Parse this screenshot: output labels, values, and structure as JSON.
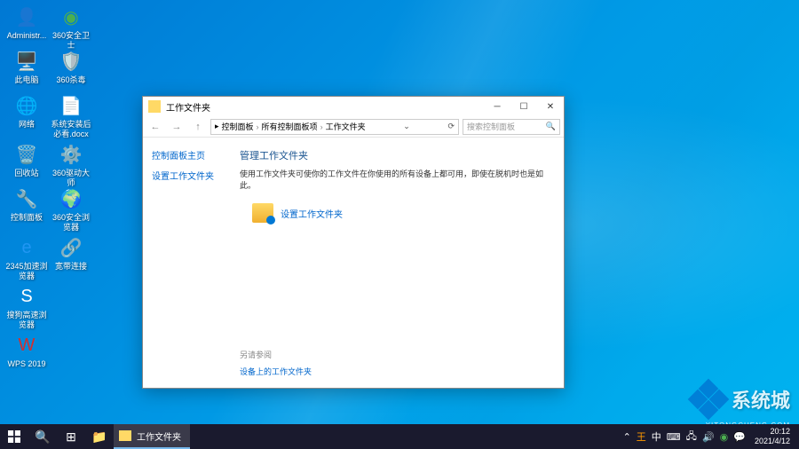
{
  "desktop_icons": {
    "admin": "Administr...",
    "360safe": "360安全卫士",
    "thispc": "此电脑",
    "360av": "360杀毒",
    "network": "网络",
    "sysinstall": "系统安装后必看.docx",
    "recycle": "回收站",
    "360drv": "360驱动大师",
    "control": "控制面板",
    "360browser": "360安全浏览器",
    "2345": "2345加速浏览器",
    "kdp": "宽带连接",
    "sogou": "搜狗高速浏览器",
    "wps": "WPS 2019"
  },
  "window": {
    "title": "工作文件夹",
    "breadcrumb": {
      "b1": "控制面板",
      "b2": "所有控制面板项",
      "b3": "工作文件夹"
    },
    "search_placeholder": "搜索控制面板",
    "sidebar": {
      "home": "控制面板主页",
      "setup": "设置工作文件夹"
    },
    "main": {
      "heading": "管理工作文件夹",
      "desc": "使用工作文件夹可使你的工作文件在你使用的所有设备上都可用，即使在脱机时也是如此。",
      "action": "设置工作文件夹"
    },
    "seealso": {
      "title": "另请参阅",
      "link": "设备上的工作文件夹"
    }
  },
  "taskbar": {
    "task_label": "工作文件夹",
    "time": "20:12",
    "date": "2021/4/12"
  },
  "watermark": {
    "text": "系统城",
    "sub": "XITONGCHENG.COM"
  }
}
